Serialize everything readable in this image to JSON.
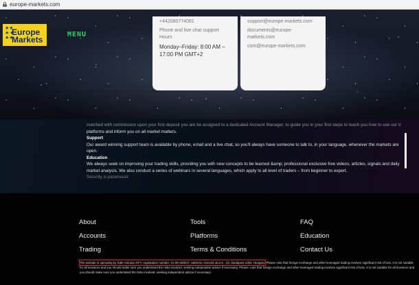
{
  "browser": {
    "url": "europe-markets.com"
  },
  "header": {
    "logo_line1": "Europe",
    "logo_line2": "Markets",
    "menu_label": "MENU"
  },
  "contact_cards": {
    "left": {
      "phone": "+442080774081",
      "support_line": "Phone and live chat support",
      "hours_label": "Hours",
      "hours": "Monday–Friday: 8:00 AM – 17:00 PM GMT+2"
    },
    "right": {
      "email1": "support@europe-markets.com",
      "email2": "documents@europe-markets.com",
      "email3": "com@europe-markets.com"
    }
  },
  "content": {
    "intro_line": "matched with commission upon your first deposit you are be assigned to a dedicated Account Manager, to guide you in your first steps to teach you how to use our trading",
    "intro_line2": "platforms and inform you on all market matters.",
    "support_heading": "Support",
    "support_text": "Our award winning support team is available by phone, email and a live chat, so you'll always have someone to talk to, in your language, whenever the markets are open.",
    "education_heading": "Education",
    "education_text": "We always seek on improving your trading skills, providing you with new concepts to be learned &amp; professional exclusive free videos, articles, signals and daily market analysis. We also conduct a series of webinars in several languages, which apply to all level of traders – from beginner to expert.",
    "cut_heading": "Security is paramount"
  },
  "footer": {
    "col1": [
      "About",
      "Accounts",
      "Trading"
    ],
    "col2": [
      "Tools",
      "Platforms",
      "Terms & Conditions"
    ],
    "col3": [
      "FAQ",
      "Education",
      "Contact Us"
    ],
    "legal_highlight": "The website is operating by Safe Solution KFT, registration number: 01-09-320017, address: Honvéd utca 8., 1/2, Budapest 1054, Hungary.",
    "legal_rest": " Please note that foreign exchange and other leveraged trading involves significant risk of loss. It is not suitable for all investors and you should make sure you understand the risks involved, seeking independent advice if necessary. Please, note that foreign exchange and other leveraged trading involves significant risk of loss. It is not suitable for all investors and you should make sure you understand the risks involved, seeking independent advice if necessary."
  }
}
